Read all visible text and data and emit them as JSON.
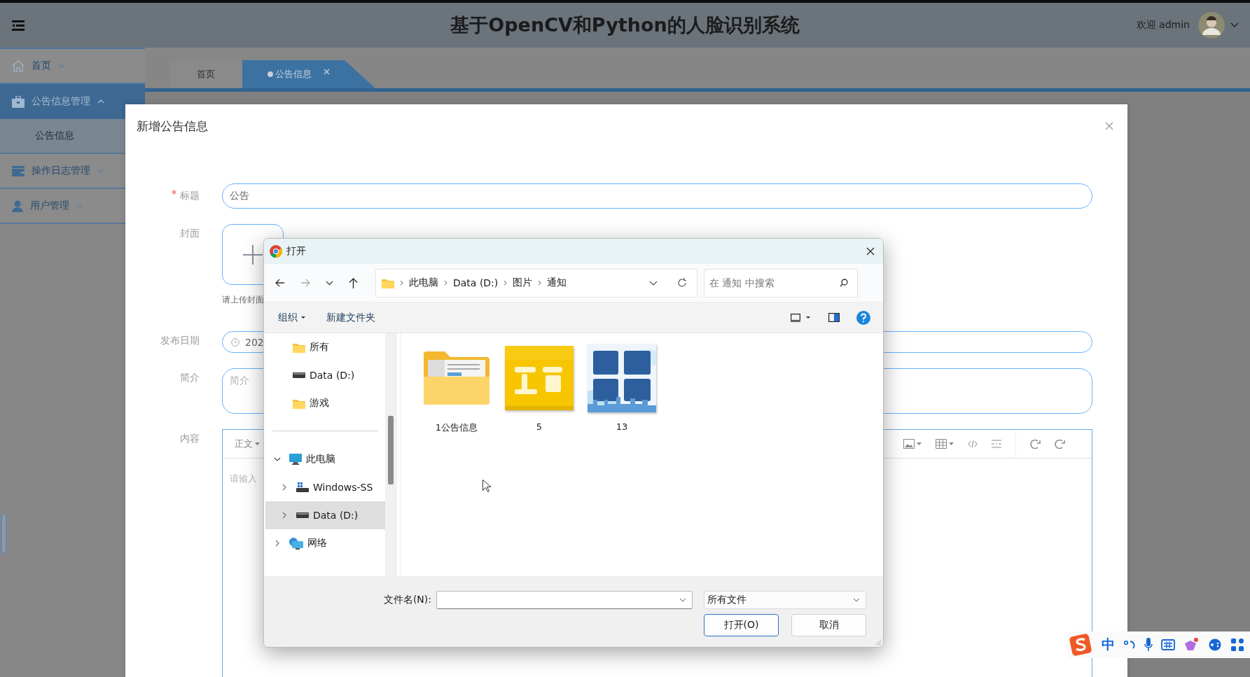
{
  "header": {
    "title": "基于OpenCV和Python的人脸识别系统",
    "greeting": "欢迎 admin"
  },
  "sidebar": {
    "items": [
      {
        "label": "首页",
        "expanded": false,
        "selected": false
      },
      {
        "label": "公告信息管理",
        "expanded": true,
        "selected": true,
        "children": [
          {
            "label": "公告信息",
            "selected": true
          }
        ]
      },
      {
        "label": "操作日志管理",
        "expanded": false,
        "selected": false
      },
      {
        "label": "用户管理",
        "expanded": false,
        "selected": false
      }
    ]
  },
  "tabs": [
    {
      "label": "首页",
      "selected": false,
      "closable": false
    },
    {
      "label": "公告信息",
      "selected": true,
      "closable": true
    }
  ],
  "modal": {
    "title": "新增公告信息",
    "fields": [
      {
        "kind": "text",
        "label": "标题",
        "required": true,
        "value": "公告"
      },
      {
        "kind": "upload",
        "label": "封面",
        "required": false,
        "hint": "请上传封面"
      },
      {
        "kind": "date",
        "label": "发布日期",
        "required": false,
        "value": "202"
      },
      {
        "kind": "textarea",
        "label": "简介",
        "required": false,
        "placeholder": "简介"
      },
      {
        "kind": "editor",
        "label": "内容",
        "required": false,
        "format": "正文",
        "placeholder": "请输入"
      }
    ]
  },
  "file_dialog": {
    "title": "打开",
    "back_enabled": true,
    "forward_enabled": false,
    "breadcrumb": [
      "此电脑",
      "Data (D:)",
      "图片",
      "通知"
    ],
    "search_placeholder": "在 通知 中搜索",
    "commands": [
      {
        "label": "组织",
        "dropdown": true
      },
      {
        "label": "新建文件夹",
        "dropdown": false
      }
    ],
    "quick_access": [
      {
        "label": "所有",
        "kind": "folder"
      },
      {
        "label": "Data (D:)",
        "kind": "drive"
      },
      {
        "label": "游戏",
        "kind": "folder"
      }
    ],
    "tree": [
      {
        "label": "此电脑",
        "kind": "pc",
        "expanded": true,
        "selected": false,
        "children": [
          {
            "label": "Windows-SS",
            "kind": "system-drive",
            "expanded": false,
            "selected": false
          },
          {
            "label": "Data (D:)",
            "kind": "drive",
            "expanded": false,
            "selected": true
          }
        ]
      },
      {
        "label": "网络",
        "kind": "network",
        "expanded": false,
        "selected": false
      }
    ],
    "files": [
      {
        "name": "1公告信息",
        "kind": "folder"
      },
      {
        "name": "5",
        "kind": "picture"
      },
      {
        "name": "13",
        "kind": "picture"
      }
    ],
    "filename_label": "文件名(N):",
    "filetype": "所有文件",
    "buttons": [
      {
        "label": "打开(O)",
        "primary": true
      },
      {
        "label": "取消",
        "primary": false
      }
    ]
  },
  "ime": {
    "mode": "中"
  }
}
